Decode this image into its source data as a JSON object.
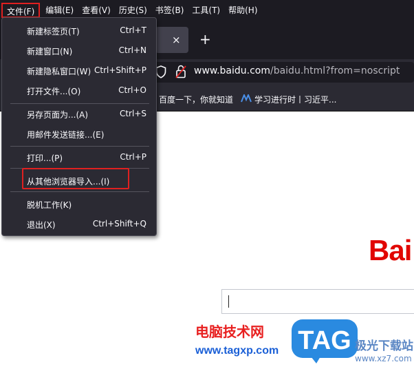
{
  "menubar": {
    "items": [
      "文件(F)",
      "编辑(E)",
      "查看(V)",
      "历史(S)",
      "书签(B)",
      "工具(T)",
      "帮助(H)"
    ]
  },
  "tab": {
    "close_glyph": "×",
    "new_tab_glyph": "+"
  },
  "urlbar": {
    "host": "www.baidu.com",
    "path": "/baidu.html?from=noscript"
  },
  "bookmarks": [
    "百度一下，你就知道",
    "学习进行时丨习近平..."
  ],
  "file_menu": {
    "items": [
      {
        "label": "新建标签页(T)",
        "shortcut": "Ctrl+T"
      },
      {
        "label": "新建窗口(N)",
        "shortcut": "Ctrl+N"
      },
      {
        "label": "新建隐私窗口(W)",
        "shortcut": "Ctrl+Shift+P"
      },
      {
        "label": "打开文件...(O)",
        "shortcut": "Ctrl+O"
      },
      {
        "label": "另存页面为...(A)",
        "shortcut": "Ctrl+S"
      },
      {
        "label": "用邮件发送链接...(E)",
        "shortcut": ""
      },
      {
        "label": "打印...(P)",
        "shortcut": "Ctrl+P"
      },
      {
        "label": "从其他浏览器导入...(I)",
        "shortcut": ""
      },
      {
        "label": "脱机工作(K)",
        "shortcut": ""
      },
      {
        "label": "退出(X)",
        "shortcut": "Ctrl+Shift+Q"
      }
    ]
  },
  "page": {
    "logo_text": "Bai"
  },
  "watermark": {
    "cn_text": "电脑技术网",
    "url_text": "www.tagxp.com",
    "logo_text": "TAG",
    "site_text": "极光下载站",
    "site_url": "www.xz7.com"
  },
  "colors": {
    "chrome_dark": "#1c1b22",
    "toolbar": "#2b2a33",
    "highlight_red": "#e02020",
    "baidu_red": "#e10601",
    "tag_blue": "#2a8ae0"
  }
}
